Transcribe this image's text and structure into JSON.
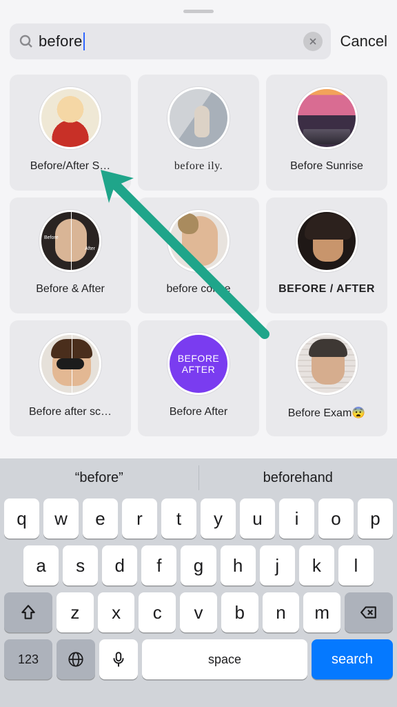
{
  "search": {
    "value": "before",
    "cancel_label": "Cancel"
  },
  "results": [
    {
      "label": "Before/After S…",
      "name": "before-after-s"
    },
    {
      "label": "before ily.",
      "name": "before-ily",
      "serif": true
    },
    {
      "label": "Before Sunrise",
      "name": "before-sunrise"
    },
    {
      "label": "Before & After",
      "name": "before-and-after"
    },
    {
      "label": "before coffee",
      "name": "before-coffee"
    },
    {
      "label": "BEFORE / AFTER",
      "name": "before-slash-after"
    },
    {
      "label": "Before after sc…",
      "name": "before-after-sc"
    },
    {
      "label": "Before After",
      "name": "before-after"
    },
    {
      "label": "Before Exam😨",
      "name": "before-exam"
    }
  ],
  "av8": {
    "line1": "BEFORE",
    "line2": "AFTER"
  },
  "av4": {
    "tag1": "Before",
    "tag2": "After"
  },
  "keyboard": {
    "suggestions": [
      "“before”",
      "beforehand"
    ],
    "row1": [
      "q",
      "w",
      "e",
      "r",
      "t",
      "y",
      "u",
      "i",
      "o",
      "p"
    ],
    "row2": [
      "a",
      "s",
      "d",
      "f",
      "g",
      "h",
      "j",
      "k",
      "l"
    ],
    "row3": [
      "z",
      "x",
      "c",
      "v",
      "b",
      "n",
      "m"
    ],
    "sym": "123",
    "space": "space",
    "search": "search"
  }
}
